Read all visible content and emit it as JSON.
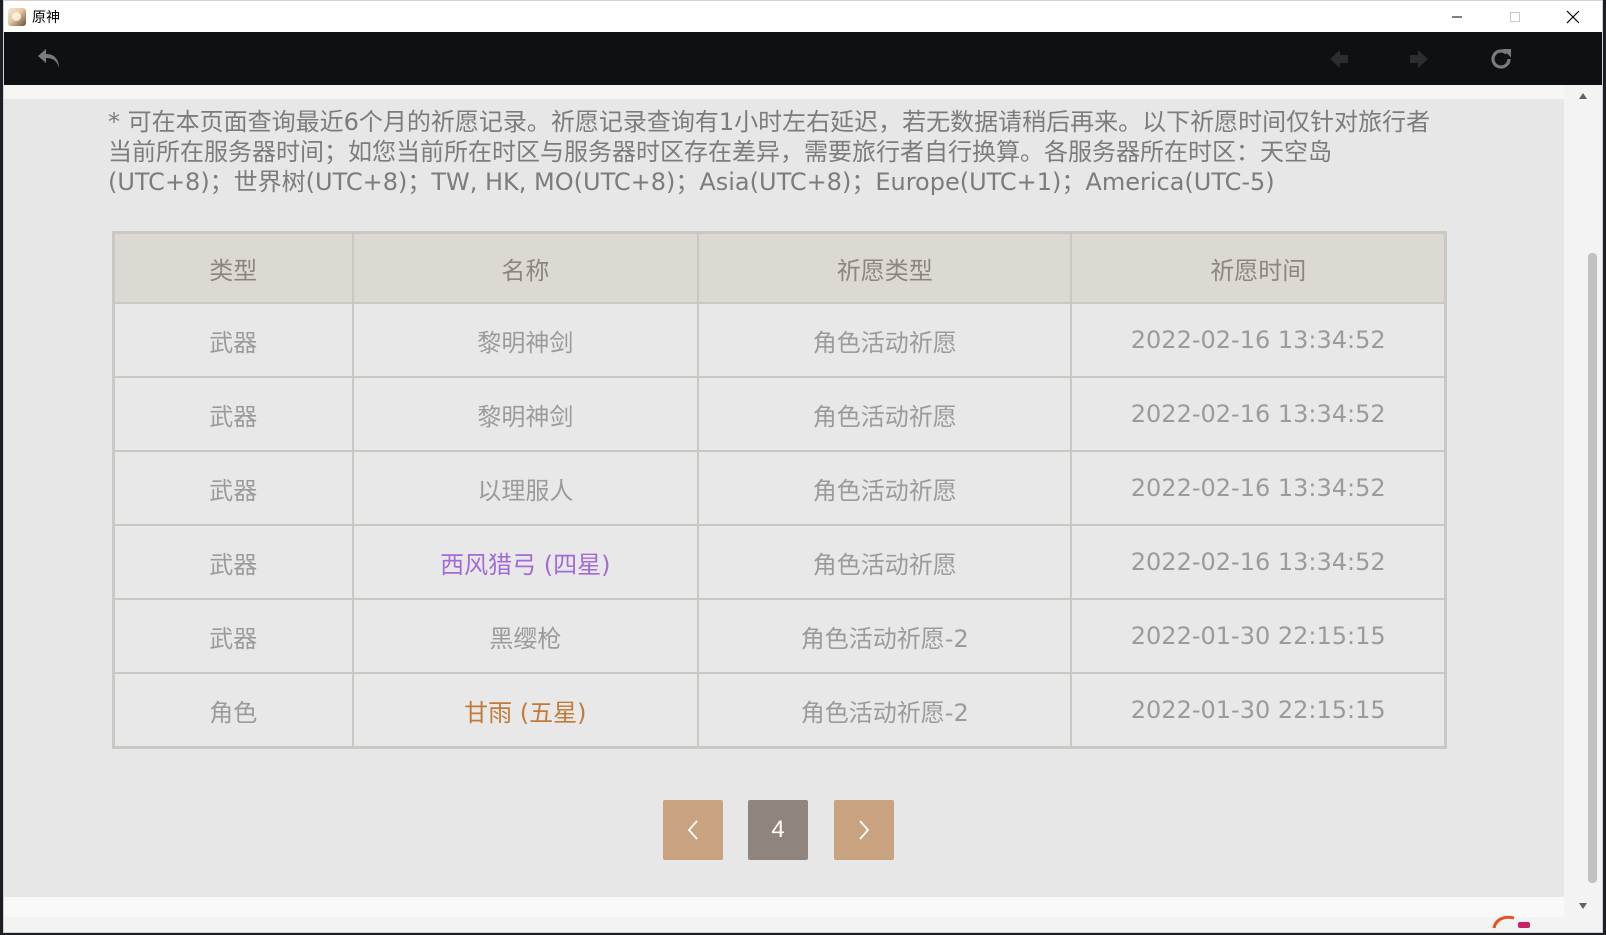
{
  "window": {
    "title": "原神"
  },
  "colors": {
    "accent_tan": "#c9a380",
    "active_page": "#8f857c",
    "four_star": "#a36bd6",
    "five_star": "#c27a3a"
  },
  "toolbar": {
    "back_icon": "back-arrow-icon",
    "prev_icon": "left-diamond-arrow-icon",
    "next_icon": "right-diamond-arrow-icon",
    "refresh_icon": "refresh-icon"
  },
  "notice": "* 可在本页面查询最近6个月的祈愿记录。祈愿记录查询有1小时左右延迟，若无数据请稍后再来。以下祈愿时间仅针对旅行者当前所在服务器时间；如您当前所在时区与服务器时区存在差异，需要旅行者自行换算。各服务器所在时区：天空岛(UTC+8)；世界树(UTC+8)；TW, HK, MO(UTC+8)；Asia(UTC+8)；Europe(UTC+1)；America(UTC-5)",
  "table": {
    "headers": [
      "类型",
      "名称",
      "祈愿类型",
      "祈愿时间"
    ],
    "rows": [
      {
        "type": "武器",
        "name": "黎明神剑",
        "rarity": "",
        "wish": "角色活动祈愿",
        "time": "2022-02-16 13:34:52"
      },
      {
        "type": "武器",
        "name": "黎明神剑",
        "rarity": "",
        "wish": "角色活动祈愿",
        "time": "2022-02-16 13:34:52"
      },
      {
        "type": "武器",
        "name": "以理服人",
        "rarity": "",
        "wish": "角色活动祈愿",
        "time": "2022-02-16 13:34:52"
      },
      {
        "type": "武器",
        "name": "西风猎弓 (四星)",
        "rarity": "4",
        "wish": "角色活动祈愿",
        "time": "2022-02-16 13:34:52"
      },
      {
        "type": "武器",
        "name": "黑缨枪",
        "rarity": "",
        "wish": "角色活动祈愿-2",
        "time": "2022-01-30 22:15:15"
      },
      {
        "type": "角色",
        "name": "甘雨 (五星)",
        "rarity": "5",
        "wish": "角色活动祈愿-2",
        "time": "2022-01-30 22:15:15"
      }
    ]
  },
  "pagination": {
    "current": "4"
  }
}
